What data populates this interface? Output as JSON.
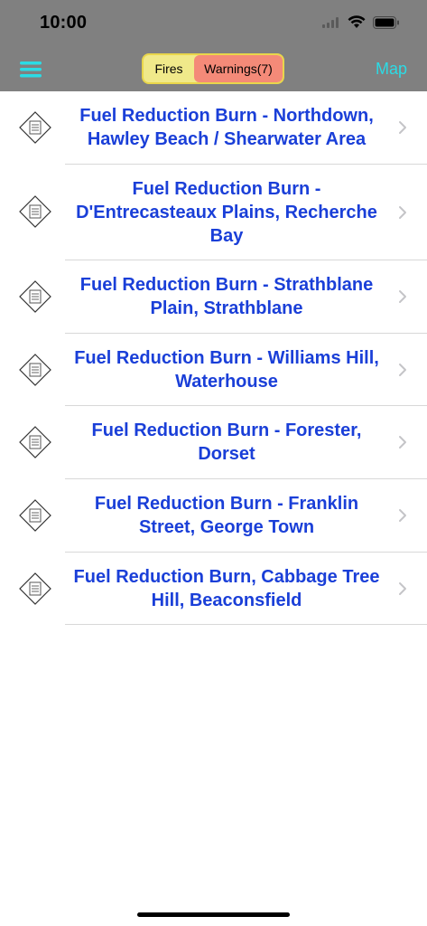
{
  "status": {
    "time": "10:00"
  },
  "navbar": {
    "menu_icon": "hamburger-menu-icon",
    "tabs": [
      {
        "label": "Fires",
        "selected": false,
        "color": "#f0e98a"
      },
      {
        "label": "Warnings(7)",
        "selected": true,
        "color": "#f48a78"
      }
    ],
    "map_label": "Map",
    "accent_color": "#2bdbe5"
  },
  "warnings": [
    {
      "title": "Fuel Reduction Burn - Northdown, Hawley Beach / Shearwater Area",
      "icon": "document-diamond-icon"
    },
    {
      "title": "Fuel Reduction Burn - D'Entrecasteaux Plains, Recherche Bay",
      "icon": "document-diamond-icon"
    },
    {
      "title": "Fuel Reduction Burn - Strathblane Plain, Strathblane",
      "icon": "document-diamond-icon"
    },
    {
      "title": "Fuel Reduction Burn - Williams Hill, Waterhouse",
      "icon": "document-diamond-icon"
    },
    {
      "title": "Fuel Reduction Burn - Forester, Dorset",
      "icon": "document-diamond-icon"
    },
    {
      "title": "Fuel Reduction Burn - Franklin Street, George Town",
      "icon": "document-diamond-icon"
    },
    {
      "title": "Fuel Reduction Burn, Cabbage Tree Hill, Beaconsfield",
      "icon": "document-diamond-icon"
    }
  ],
  "colors": {
    "title_text": "#1a3fd8",
    "bar_background": "#808080"
  }
}
